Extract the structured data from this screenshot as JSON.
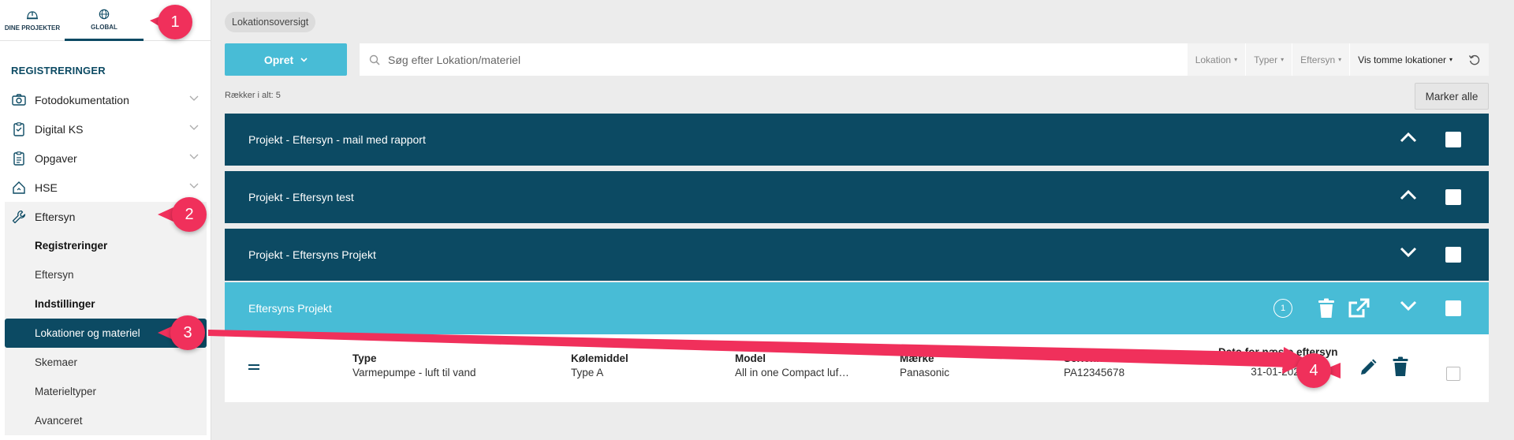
{
  "topnav": {
    "projects_label": "DINE PROJEKTER",
    "global_label": "GLOBAL"
  },
  "sidebar": {
    "heading": "REGISTRERINGER",
    "items": [
      {
        "label": "Fotodokumentation",
        "icon": "camera-icon"
      },
      {
        "label": "Digital KS",
        "icon": "clipboard-icon"
      },
      {
        "label": "Opgaver",
        "icon": "clipboard-list-icon"
      },
      {
        "label": "HSE",
        "icon": "house-icon"
      },
      {
        "label": "Eftersyn",
        "icon": "wrench-icon"
      }
    ],
    "subitems": [
      {
        "label": "Registreringer"
      },
      {
        "label": "Eftersyn"
      },
      {
        "label": "Indstillinger"
      },
      {
        "label": "Lokationer og materiel"
      },
      {
        "label": "Skemaer"
      },
      {
        "label": "Materieltyper"
      },
      {
        "label": "Avanceret"
      }
    ]
  },
  "header": {
    "chip": "Lokationsoversigt"
  },
  "toolbar": {
    "opret_label": "Opret",
    "search_placeholder": "Søg efter Lokation/materiel",
    "filters": [
      "Lokation",
      "Typer",
      "Eftersyn",
      "Vis tomme lokationer"
    ]
  },
  "row_count": "Rækker i alt: 5",
  "mark_all": "Marker alle",
  "groups": [
    {
      "title": "Projekt - Eftersyn - mail med rapport"
    },
    {
      "title": "Projekt - Eftersyn test"
    },
    {
      "title": "Projekt - Eftersyns Projekt"
    },
    {
      "title": "Eftersyns Projekt",
      "badge": "1"
    }
  ],
  "detail": {
    "columns": [
      {
        "header": "Type",
        "value": "Varmepumpe - luft til vand"
      },
      {
        "header": "Kølemiddel",
        "value": "Type A"
      },
      {
        "header": "Model",
        "value": "All in one Compact luf…"
      },
      {
        "header": "Mærke",
        "value": "Panasonic"
      },
      {
        "header": "Serienr.",
        "value": "PA12345678"
      },
      {
        "header": "Dato for næste eftersyn",
        "value": "31-01-2024"
      }
    ]
  },
  "annotations": [
    "1",
    "2",
    "3",
    "4"
  ],
  "colors": {
    "dark": "#0c4a63",
    "accent": "#48bcd6",
    "marker": "#f0305b"
  }
}
